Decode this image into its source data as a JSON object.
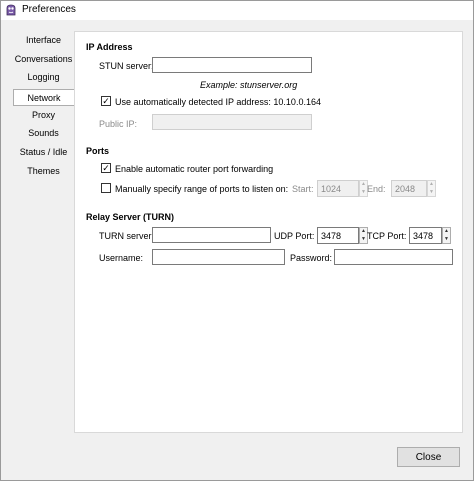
{
  "window": {
    "title": "Preferences"
  },
  "tabs": [
    "Interface",
    "Conversations",
    "Logging",
    "Network",
    "Proxy",
    "Sounds",
    "Status / Idle",
    "Themes"
  ],
  "ip": {
    "heading": "IP Address",
    "stun_label": "STUN server:",
    "stun_value": "",
    "example": "Example: stunserver.org",
    "auto_label": "Use automatically detected IP address: 10.10.0.164",
    "auto_checked": true,
    "public_label": "Public IP:",
    "public_value": ""
  },
  "ports": {
    "heading": "Ports",
    "upnp_label": "Enable automatic router port forwarding",
    "upnp_checked": true,
    "manual_label": "Manually specify range of ports to listen on:",
    "manual_checked": false,
    "start_label": "Start:",
    "start_value": "1024",
    "end_label": "End:",
    "end_value": "2048"
  },
  "relay": {
    "heading": "Relay Server (TURN)",
    "turn_label": "TURN server:",
    "turn_value": "",
    "udp_label": "UDP Port:",
    "udp_value": "3478",
    "tcp_label": "TCP Port:",
    "tcp_value": "3478",
    "user_label": "Username:",
    "user_value": "",
    "pass_label": "Password:",
    "pass_value": ""
  },
  "footer": {
    "close_label": "Close"
  },
  "icons": {
    "app": "pidgin-icon"
  }
}
